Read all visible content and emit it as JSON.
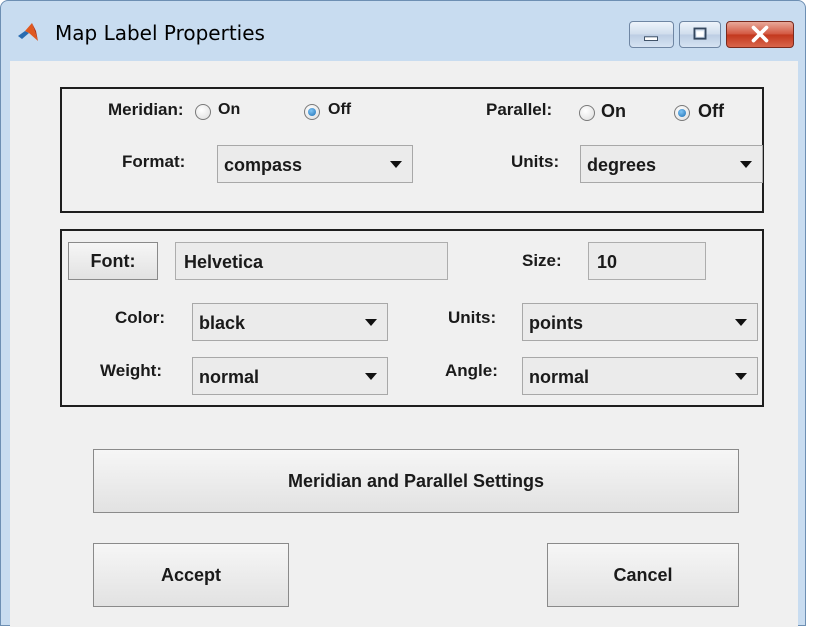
{
  "window": {
    "title": "Map Label Properties",
    "app_icon": "matlab-logo-icon",
    "controls": [
      "minimize-icon",
      "maximize-icon",
      "close-icon"
    ]
  },
  "label_settings": {
    "meridian_label": "Meridian:",
    "meridian_options": [
      {
        "label": "On",
        "selected": false
      },
      {
        "label": "Off",
        "selected": true
      }
    ],
    "parallel_label": "Parallel:",
    "parallel_options": [
      {
        "label": "On",
        "selected": false
      },
      {
        "label": "Off",
        "selected": true
      }
    ],
    "format_label": "Format:",
    "format_value": "compass",
    "units_label": "Units:",
    "units_value": "degrees"
  },
  "font_settings": {
    "font_button": "Font:",
    "font_name": "Helvetica",
    "size_label": "Size:",
    "size_value": "10",
    "color_label": "Color:",
    "color_value": "black",
    "units_label": "Units:",
    "units_value": "points",
    "weight_label": "Weight:",
    "weight_value": "normal",
    "angle_label": "Angle:",
    "angle_value": "normal"
  },
  "buttons": {
    "settings": "Meridian and Parallel Settings",
    "accept": "Accept",
    "cancel": "Cancel"
  },
  "colors": {
    "frame": "#c8dcf0",
    "client": "#f0f0f0",
    "close_button": "#c2371d",
    "radio_selected": "#1d6fb4"
  }
}
